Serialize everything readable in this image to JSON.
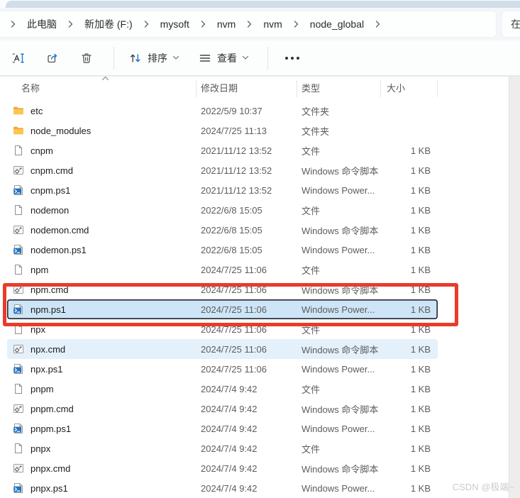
{
  "breadcrumb": {
    "items": [
      "此电脑",
      "新加卷 (F:)",
      "mysoft",
      "nvm",
      "nvm",
      "node_global"
    ]
  },
  "search": {
    "visible_text": "在"
  },
  "toolbar": {
    "sort_label": "排序",
    "view_label": "查看",
    "icons": [
      "rename-icon",
      "share-icon",
      "delete-icon",
      "sort-icon",
      "view-icon",
      "more-options-icon"
    ]
  },
  "list": {
    "columns": [
      "名称",
      "修改日期",
      "类型",
      "大小"
    ],
    "sort": {
      "column": "名称",
      "direction": "ascending"
    },
    "rows": [
      {
        "name": "etc",
        "icon": "folder",
        "date": "2022/5/9 10:37",
        "type": "文件夹",
        "size": ""
      },
      {
        "name": "node_modules",
        "icon": "folder",
        "date": "2024/7/25 11:13",
        "type": "文件夹",
        "size": ""
      },
      {
        "name": "cnpm",
        "icon": "file",
        "date": "2021/11/12 13:52",
        "type": "文件",
        "size": "1 KB"
      },
      {
        "name": "cnpm.cmd",
        "icon": "cmd",
        "date": "2021/11/12 13:52",
        "type": "Windows 命令脚本",
        "size": "1 KB"
      },
      {
        "name": "cnpm.ps1",
        "icon": "ps1",
        "date": "2021/11/12 13:52",
        "type": "Windows Power...",
        "size": "1 KB"
      },
      {
        "name": "nodemon",
        "icon": "file",
        "date": "2022/6/8 15:05",
        "type": "文件",
        "size": "1 KB"
      },
      {
        "name": "nodemon.cmd",
        "icon": "cmd",
        "date": "2022/6/8 15:05",
        "type": "Windows 命令脚本",
        "size": "1 KB"
      },
      {
        "name": "nodemon.ps1",
        "icon": "ps1",
        "date": "2022/6/8 15:05",
        "type": "Windows Power...",
        "size": "1 KB"
      },
      {
        "name": "npm",
        "icon": "file",
        "date": "2024/7/25 11:06",
        "type": "文件",
        "size": "1 KB"
      },
      {
        "name": "npm.cmd",
        "icon": "cmd",
        "date": "2024/7/25 11:06",
        "type": "Windows 命令脚本",
        "size": "1 KB"
      },
      {
        "name": "npm.ps1",
        "icon": "ps1",
        "date": "2024/7/25 11:06",
        "type": "Windows Power...",
        "size": "1 KB",
        "state": "selected"
      },
      {
        "name": "npx",
        "icon": "file",
        "date": "2024/7/25 11:06",
        "type": "文件",
        "size": "1 KB"
      },
      {
        "name": "npx.cmd",
        "icon": "cmd",
        "date": "2024/7/25 11:06",
        "type": "Windows 命令脚本",
        "size": "1 KB",
        "state": "hover"
      },
      {
        "name": "npx.ps1",
        "icon": "ps1",
        "date": "2024/7/25 11:06",
        "type": "Windows Power...",
        "size": "1 KB"
      },
      {
        "name": "pnpm",
        "icon": "file",
        "date": "2024/7/4 9:42",
        "type": "文件",
        "size": "1 KB"
      },
      {
        "name": "pnpm.cmd",
        "icon": "cmd",
        "date": "2024/7/4 9:42",
        "type": "Windows 命令脚本",
        "size": "1 KB"
      },
      {
        "name": "pnpm.ps1",
        "icon": "ps1",
        "date": "2024/7/4 9:42",
        "type": "Windows Power...",
        "size": "1 KB"
      },
      {
        "name": "pnpx",
        "icon": "file",
        "date": "2024/7/4 9:42",
        "type": "文件",
        "size": "1 KB"
      },
      {
        "name": "pnpx.cmd",
        "icon": "cmd",
        "date": "2024/7/4 9:42",
        "type": "Windows 命令脚本",
        "size": "1 KB"
      },
      {
        "name": "pnpx.ps1",
        "icon": "ps1",
        "date": "2024/7/4 9:42",
        "type": "Windows Power...",
        "size": "1 KB"
      }
    ]
  },
  "annotation": {
    "shape": "rectangle",
    "color": "#e93b2a"
  },
  "watermark": {
    "text": "CSDN @极端~"
  },
  "colors": {
    "selection_bg": "#cde5f7",
    "hover_bg": "#e4f0fa",
    "accent_blue": "#1973d2",
    "folder_yellow": "#fcc64f",
    "tab_strip": "#cfdee9",
    "annotation_red": "#e93b2a"
  }
}
